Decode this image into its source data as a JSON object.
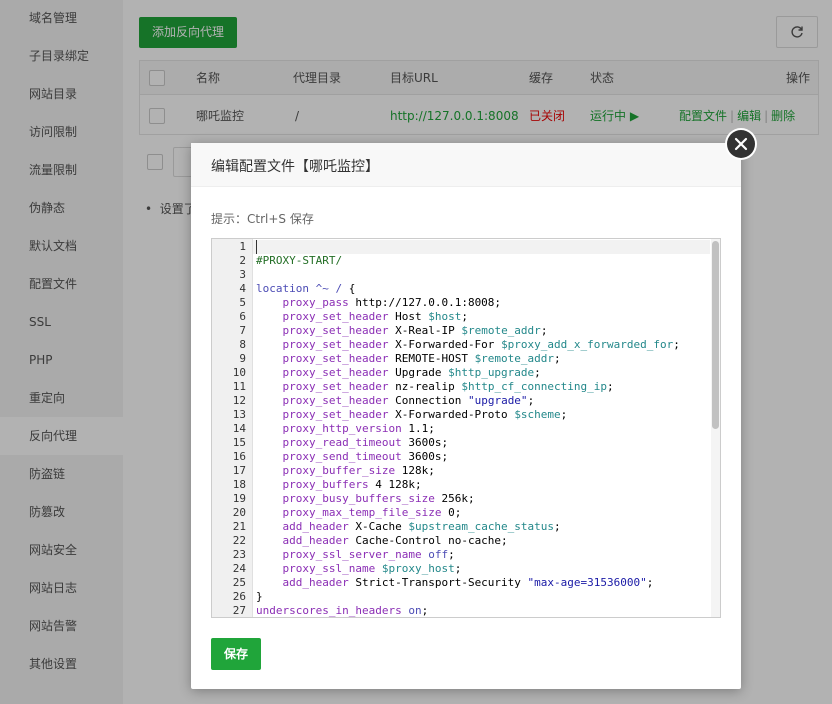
{
  "sidebar": {
    "items": [
      "域名管理",
      "子目录绑定",
      "网站目录",
      "访问限制",
      "流量限制",
      "伪静态",
      "默认文档",
      "配置文件",
      "SSL",
      "PHP",
      "重定向",
      "反向代理",
      "防盗链",
      "防篡改",
      "网站安全",
      "网站日志",
      "网站告警",
      "其他设置"
    ],
    "active": "反向代理"
  },
  "toolbar": {
    "add_label": "添加反向代理",
    "refresh_icon": "refresh-icon"
  },
  "table": {
    "headers": [
      "名称",
      "代理目录",
      "目标URL",
      "缓存",
      "状态",
      "操作"
    ],
    "rows": [
      {
        "name": "哪吒监控",
        "dir": "/",
        "url": "http://127.0.0.1:8008",
        "cache": "已关闭",
        "status": "运行中 ▶",
        "actions": [
          "配置文件",
          "编辑",
          "删除"
        ]
      }
    ]
  },
  "background_note": "设置了",
  "modal": {
    "title": "编辑配置文件【哪吒监控】",
    "hint": "提示：Ctrl+S 保存",
    "save_label": "保存",
    "close_icon": "close-icon",
    "line_numbers": [
      "1",
      "2",
      "3",
      "4",
      "5",
      "6",
      "7",
      "8",
      "9",
      "10",
      "11",
      "12",
      "13",
      "14",
      "15",
      "16",
      "17",
      "18",
      "19",
      "20",
      "21",
      "22",
      "23",
      "24",
      "25",
      "26",
      "27"
    ],
    "code_lines": [
      "",
      "#PROXY-START/",
      "",
      "location ^~ / {",
      "    proxy_pass http://127.0.0.1:8008;",
      "    proxy_set_header Host $host;",
      "    proxy_set_header X-Real-IP $remote_addr;",
      "    proxy_set_header X-Forwarded-For $proxy_add_x_forwarded_for;",
      "    proxy_set_header REMOTE-HOST $remote_addr;",
      "    proxy_set_header Upgrade $http_upgrade;",
      "    proxy_set_header nz-realip $http_cf_connecting_ip;",
      "    proxy_set_header Connection \"upgrade\";",
      "    proxy_set_header X-Forwarded-Proto $scheme;",
      "    proxy_http_version 1.1;",
      "    proxy_read_timeout 3600s;",
      "    proxy_send_timeout 3600s;",
      "    proxy_buffer_size 128k;",
      "    proxy_buffers 4 128k;",
      "    proxy_busy_buffers_size 256k;",
      "    proxy_max_temp_file_size 0;",
      "    add_header X-Cache $upstream_cache_status;",
      "    add_header Cache-Control no-cache;",
      "    proxy_ssl_server_name off;",
      "    proxy_ssl_name $proxy_host;",
      "    add_header Strict-Transport-Security \"max-age=31536000\";",
      "}",
      "underscores_in_headers on;"
    ]
  },
  "colors": {
    "accent": "#20a53a",
    "danger": "#ef0808"
  }
}
